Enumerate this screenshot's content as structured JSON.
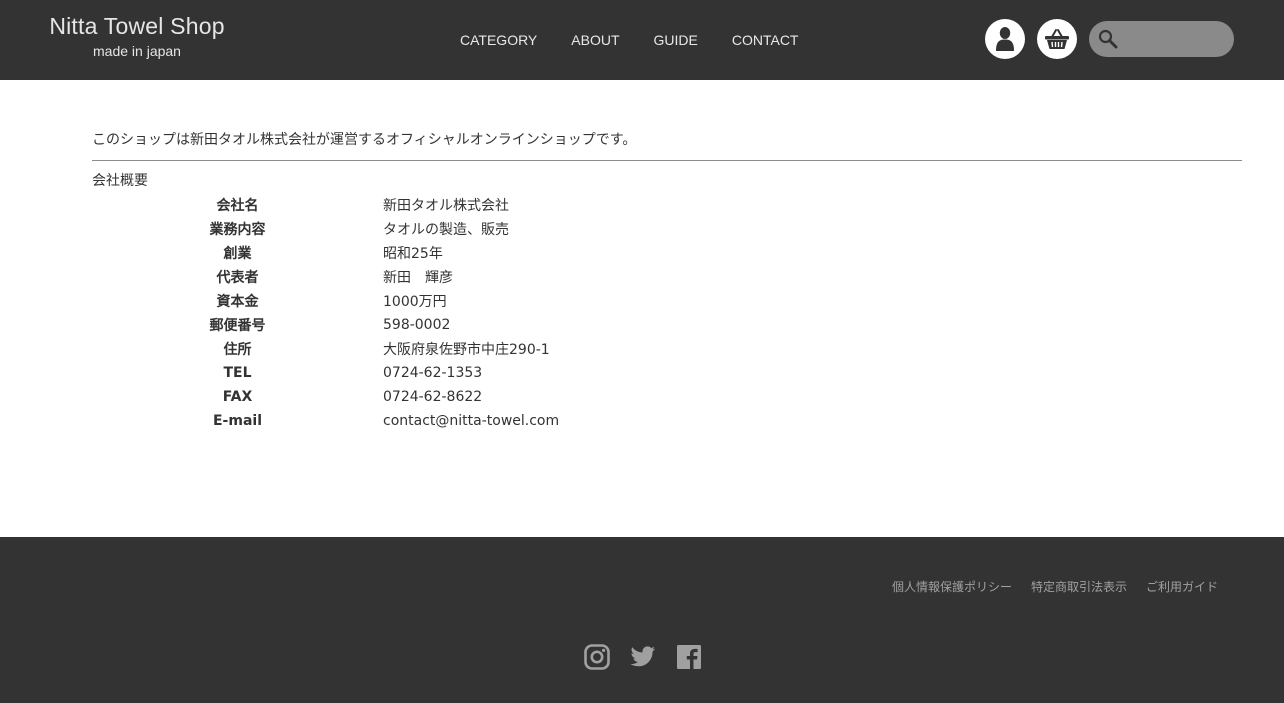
{
  "header": {
    "logo_title": "Nitta Towel Shop",
    "logo_subtitle": "made in japan",
    "nav": [
      {
        "label": "CATEGORY"
      },
      {
        "label": "ABOUT"
      },
      {
        "label": "GUIDE"
      },
      {
        "label": "CONTACT"
      }
    ],
    "user_icon": "user-icon",
    "cart_icon": "basket-icon",
    "search": {
      "value": "",
      "icon": "search-icon"
    }
  },
  "main": {
    "intro": "このショップは新田タオル株式会社が運営するオフィシャルオンラインショップです。",
    "section_title": "会社概要",
    "company": [
      {
        "label": "会社名",
        "value": "新田タオル株式会社"
      },
      {
        "label": "業務内容",
        "value": "タオルの製造、販売"
      },
      {
        "label": "創業",
        "value": "昭和25年"
      },
      {
        "label": "代表者",
        "value": "新田　輝彦"
      },
      {
        "label": "資本金",
        "value": "1000万円"
      },
      {
        "label": "郵便番号",
        "value": "598-0002"
      },
      {
        "label": "住所",
        "value": "大阪府泉佐野市中庄290-1"
      },
      {
        "label": "TEL",
        "value": "0724-62-1353"
      },
      {
        "label": "FAX",
        "value": "0724-62-8622"
      },
      {
        "label": "E-mail",
        "value": "contact@nitta-towel.com"
      }
    ]
  },
  "footer": {
    "links": [
      {
        "label": "個人情報保護ポリシー"
      },
      {
        "label": "特定商取引法表示"
      },
      {
        "label": "ご利用ガイド"
      }
    ],
    "social": [
      "instagram-icon",
      "twitter-icon",
      "facebook-icon"
    ]
  },
  "colors": {
    "header_bg": "#333333",
    "footer_bg": "#333333",
    "search_bg": "#8a8a8a",
    "text": "#333333"
  }
}
